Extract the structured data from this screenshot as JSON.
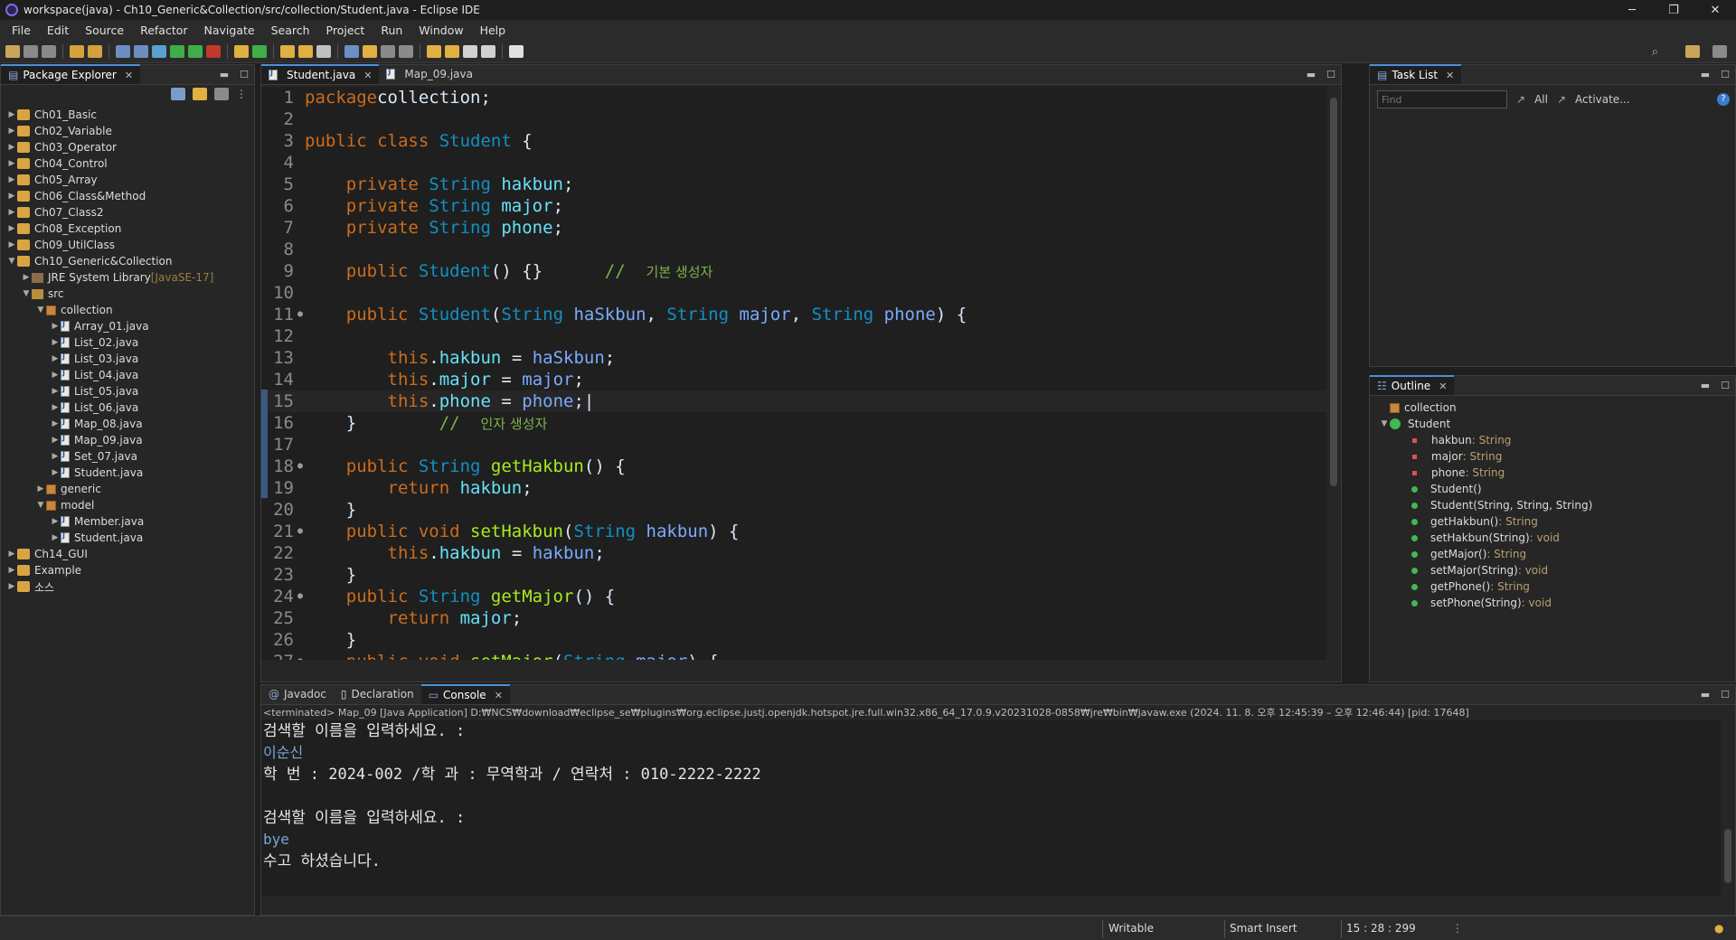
{
  "window": {
    "title": "workspace(java) - Ch10_Generic&Collection/src/collection/Student.java - Eclipse IDE",
    "controls": {
      "minimize": "─",
      "restore": "❐",
      "close": "✕"
    }
  },
  "menu": [
    "File",
    "Edit",
    "Source",
    "Refactor",
    "Navigate",
    "Search",
    "Project",
    "Run",
    "Window",
    "Help"
  ],
  "package_explorer": {
    "title": "Package Explorer",
    "items": [
      {
        "label": "Ch01_Basic",
        "kind": "project",
        "indent": 0,
        "expanded": false
      },
      {
        "label": "Ch02_Variable",
        "kind": "project",
        "indent": 0,
        "expanded": false
      },
      {
        "label": "Ch03_Operator",
        "kind": "project",
        "indent": 0,
        "expanded": false
      },
      {
        "label": "Ch04_Control",
        "kind": "project",
        "indent": 0,
        "expanded": false
      },
      {
        "label": "Ch05_Array",
        "kind": "project",
        "indent": 0,
        "expanded": false
      },
      {
        "label": "Ch06_Class&Method",
        "kind": "project",
        "indent": 0,
        "expanded": false
      },
      {
        "label": "Ch07_Class2",
        "kind": "project",
        "indent": 0,
        "expanded": false
      },
      {
        "label": "Ch08_Exception",
        "kind": "project",
        "indent": 0,
        "expanded": false
      },
      {
        "label": "Ch09_UtilClass",
        "kind": "project",
        "indent": 0,
        "expanded": false
      },
      {
        "label": "Ch10_Generic&Collection",
        "kind": "project",
        "indent": 0,
        "expanded": true
      },
      {
        "label": "JRE System Library",
        "suffix": "[JavaSE-17]",
        "kind": "lib",
        "indent": 1,
        "expanded": false
      },
      {
        "label": "src",
        "kind": "src",
        "indent": 1,
        "expanded": true
      },
      {
        "label": "collection",
        "kind": "package",
        "indent": 2,
        "expanded": true
      },
      {
        "label": "Array_01.java",
        "kind": "java",
        "indent": 3,
        "expanded": false
      },
      {
        "label": "List_02.java",
        "kind": "java",
        "indent": 3,
        "expanded": false
      },
      {
        "label": "List_03.java",
        "kind": "java",
        "indent": 3,
        "expanded": false
      },
      {
        "label": "List_04.java",
        "kind": "java",
        "indent": 3,
        "expanded": false
      },
      {
        "label": "List_05.java",
        "kind": "java",
        "indent": 3,
        "expanded": false
      },
      {
        "label": "List_06.java",
        "kind": "java",
        "indent": 3,
        "expanded": false
      },
      {
        "label": "Map_08.java",
        "kind": "java",
        "indent": 3,
        "expanded": false
      },
      {
        "label": "Map_09.java",
        "kind": "java",
        "indent": 3,
        "expanded": false
      },
      {
        "label": "Set_07.java",
        "kind": "java",
        "indent": 3,
        "expanded": false
      },
      {
        "label": "Student.java",
        "kind": "java",
        "indent": 3,
        "expanded": false
      },
      {
        "label": "generic",
        "kind": "package",
        "indent": 2,
        "expanded": false
      },
      {
        "label": "model",
        "kind": "package",
        "indent": 2,
        "expanded": true
      },
      {
        "label": "Member.java",
        "kind": "java",
        "indent": 3,
        "expanded": false
      },
      {
        "label": "Student.java",
        "kind": "java",
        "indent": 3,
        "expanded": false
      },
      {
        "label": "Ch14_GUI",
        "kind": "project",
        "indent": 0,
        "expanded": false
      },
      {
        "label": "Example",
        "kind": "project",
        "indent": 0,
        "expanded": false
      },
      {
        "label": "소스",
        "kind": "project",
        "indent": 0,
        "expanded": false
      }
    ]
  },
  "editor": {
    "tabs": [
      {
        "label": "Student.java",
        "active": true
      },
      {
        "label": "Map_09.java",
        "active": false
      }
    ],
    "lines": [
      {
        "n": "1",
        "dot": false,
        "seg": [
          [
            "kw",
            "package"
          ],
          [
            "",
            "collection;"
          ]
        ]
      },
      {
        "n": "2",
        "dot": false,
        "seg": []
      },
      {
        "n": "3",
        "dot": false,
        "seg": [
          [
            "kw",
            "public class "
          ],
          [
            "ty",
            "Student"
          ],
          [
            "",
            " {"
          ]
        ]
      },
      {
        "n": "4",
        "dot": false,
        "seg": []
      },
      {
        "n": "5",
        "dot": false,
        "seg": [
          [
            "",
            "    "
          ],
          [
            "kw",
            "private "
          ],
          [
            "ty",
            "String "
          ],
          [
            "fld",
            "hakbun"
          ],
          [
            "",
            ";"
          ]
        ]
      },
      {
        "n": "6",
        "dot": false,
        "seg": [
          [
            "",
            "    "
          ],
          [
            "kw",
            "private "
          ],
          [
            "ty",
            "String "
          ],
          [
            "fld",
            "major"
          ],
          [
            "",
            ";"
          ]
        ]
      },
      {
        "n": "7",
        "dot": false,
        "seg": [
          [
            "",
            "    "
          ],
          [
            "kw",
            "private "
          ],
          [
            "ty",
            "String "
          ],
          [
            "fld",
            "phone"
          ],
          [
            "",
            ";"
          ]
        ]
      },
      {
        "n": "8",
        "dot": false,
        "seg": []
      },
      {
        "n": "9",
        "dot": false,
        "seg": [
          [
            "",
            "    "
          ],
          [
            "kw",
            "public "
          ],
          [
            "ty",
            "Student"
          ],
          [
            "",
            "() {}      "
          ],
          [
            "cm",
            "//  "
          ],
          [
            "ko",
            "기본 생성자"
          ]
        ]
      },
      {
        "n": "10",
        "dot": false,
        "seg": []
      },
      {
        "n": "11",
        "dot": true,
        "seg": [
          [
            "",
            "    "
          ],
          [
            "kw",
            "public "
          ],
          [
            "ty",
            "Student"
          ],
          [
            "",
            "("
          ],
          [
            "ty",
            "String "
          ],
          [
            "prm",
            "haSkbun"
          ],
          [
            ", "
          ],
          [
            "ty",
            "String "
          ],
          [
            "prm",
            "major"
          ],
          [
            ", "
          ],
          [
            "ty",
            "String "
          ],
          [
            "prm",
            "phone"
          ],
          [
            ") {"
          ]
        ]
      },
      {
        "n": "12",
        "dot": false,
        "seg": []
      },
      {
        "n": "13",
        "dot": false,
        "seg": [
          [
            "",
            "        "
          ],
          [
            "kw",
            "this"
          ],
          [
            "",
            "."
          ],
          [
            "fld",
            "hakbun"
          ],
          [
            "",
            " = "
          ],
          [
            "prm",
            "haSkbun"
          ],
          [
            "",
            ";"
          ]
        ]
      },
      {
        "n": "14",
        "dot": false,
        "seg": [
          [
            "",
            "        "
          ],
          [
            "kw",
            "this"
          ],
          [
            "",
            "."
          ],
          [
            "fld",
            "major"
          ],
          [
            "",
            " = "
          ],
          [
            "prm",
            "major"
          ],
          [
            "",
            ";"
          ]
        ]
      },
      {
        "n": "15",
        "dot": false,
        "seg": [
          [
            "",
            "        "
          ],
          [
            "kw",
            "this"
          ],
          [
            "",
            "."
          ],
          [
            "fld",
            "phone"
          ],
          [
            "",
            " = "
          ],
          [
            "prm",
            "phone"
          ],
          [
            "",
            ";|"
          ]
        ]
      },
      {
        "n": "16",
        "dot": false,
        "seg": [
          [
            "",
            "    }        "
          ],
          [
            "cm",
            "//  "
          ],
          [
            "ko",
            "인자 생성자"
          ]
        ]
      },
      {
        "n": "17",
        "dot": false,
        "seg": []
      },
      {
        "n": "18",
        "dot": true,
        "seg": [
          [
            "",
            "    "
          ],
          [
            "kw",
            "public "
          ],
          [
            "ty",
            "String "
          ],
          [
            "mth",
            "getHakbun"
          ],
          [
            "",
            "() {"
          ]
        ]
      },
      {
        "n": "19",
        "dot": false,
        "seg": [
          [
            "",
            "        "
          ],
          [
            "kw",
            "return "
          ],
          [
            "fld",
            "hakbun"
          ],
          [
            "",
            ";"
          ]
        ]
      },
      {
        "n": "20",
        "dot": false,
        "seg": [
          [
            "",
            "    }"
          ]
        ]
      },
      {
        "n": "21",
        "dot": true,
        "seg": [
          [
            "",
            "    "
          ],
          [
            "kw",
            "public void "
          ],
          [
            "mth",
            "setHakbun"
          ],
          [
            "",
            "("
          ],
          [
            "ty",
            "String "
          ],
          [
            "prm",
            "hakbun"
          ],
          [
            "",
            ") {"
          ]
        ]
      },
      {
        "n": "22",
        "dot": false,
        "seg": [
          [
            "",
            "        "
          ],
          [
            "kw",
            "this"
          ],
          [
            "",
            "."
          ],
          [
            "fld",
            "hakbun"
          ],
          [
            "",
            " = "
          ],
          [
            "prm",
            "hakbun"
          ],
          [
            "",
            ";"
          ]
        ]
      },
      {
        "n": "23",
        "dot": false,
        "seg": [
          [
            "",
            "    }"
          ]
        ]
      },
      {
        "n": "24",
        "dot": true,
        "seg": [
          [
            "",
            "    "
          ],
          [
            "kw",
            "public "
          ],
          [
            "ty",
            "String "
          ],
          [
            "mth",
            "getMajor"
          ],
          [
            "",
            "() {"
          ]
        ]
      },
      {
        "n": "25",
        "dot": false,
        "seg": [
          [
            "",
            "        "
          ],
          [
            "kw",
            "return "
          ],
          [
            "fld",
            "major"
          ],
          [
            "",
            ";"
          ]
        ]
      },
      {
        "n": "26",
        "dot": false,
        "seg": [
          [
            "",
            "    }"
          ]
        ]
      },
      {
        "n": "27",
        "dot": true,
        "seg": [
          [
            "",
            "    "
          ],
          [
            "kw",
            "public void "
          ],
          [
            "mth",
            "setMajor"
          ],
          [
            "",
            "("
          ],
          [
            "ty",
            "String "
          ],
          [
            "prm",
            "major"
          ],
          [
            "",
            ") {"
          ]
        ]
      }
    ]
  },
  "task_list": {
    "title": "Task List",
    "find_placeholder": "Find",
    "all_label": "All",
    "activate_label": "Activate..."
  },
  "outline": {
    "title": "Outline",
    "package": "collection",
    "class": "Student",
    "members": [
      {
        "name": "hakbun",
        "type": " : String",
        "kind": "field"
      },
      {
        "name": "major",
        "type": " : String",
        "kind": "field"
      },
      {
        "name": "phone",
        "type": " : String",
        "kind": "field"
      },
      {
        "name": "Student()",
        "type": "",
        "kind": "ctor"
      },
      {
        "name": "Student(String, String, String)",
        "type": "",
        "kind": "ctor"
      },
      {
        "name": "getHakbun()",
        "type": " : String",
        "kind": "method"
      },
      {
        "name": "setHakbun(String)",
        "type": " : void",
        "kind": "method"
      },
      {
        "name": "getMajor()",
        "type": " : String",
        "kind": "method"
      },
      {
        "name": "setMajor(String)",
        "type": " : void",
        "kind": "method"
      },
      {
        "name": "getPhone()",
        "type": " : String",
        "kind": "method"
      },
      {
        "name": "setPhone(String)",
        "type": " : void",
        "kind": "method"
      }
    ]
  },
  "bottom_tabs": [
    {
      "label": "Javadoc",
      "active": false
    },
    {
      "label": "Declaration",
      "active": false
    },
    {
      "label": "Console",
      "active": true
    }
  ],
  "console": {
    "header": "<terminated> Map_09 [Java Application] D:₩NCS₩download₩eclipse_se₩plugins₩org.eclipse.justj.openjdk.hotspot.jre.full.win32.x86_64_17.0.9.v20231028-0858₩jre₩bin₩javaw.exe  (2024. 11. 8. 오후 12:45:39 – 오후 12:46:44) [pid: 17648]",
    "lines": [
      {
        "text": "검색할 이름을 입력하세요. :",
        "input": false
      },
      {
        "text": "이순신",
        "input": true
      },
      {
        "text": "학 번 : 2024-002 /학 과 : 무역학과 / 연락처 : 010-2222-2222",
        "input": false
      },
      {
        "text": "",
        "input": false
      },
      {
        "text": "검색할 이름을 입력하세요. :",
        "input": false
      },
      {
        "text": "bye",
        "input": true
      },
      {
        "text": "수고 하셨습니다.",
        "input": false
      }
    ]
  },
  "status": {
    "writable": "Writable",
    "insert_mode": "Smart Insert",
    "position": "15 : 28 : 299"
  }
}
